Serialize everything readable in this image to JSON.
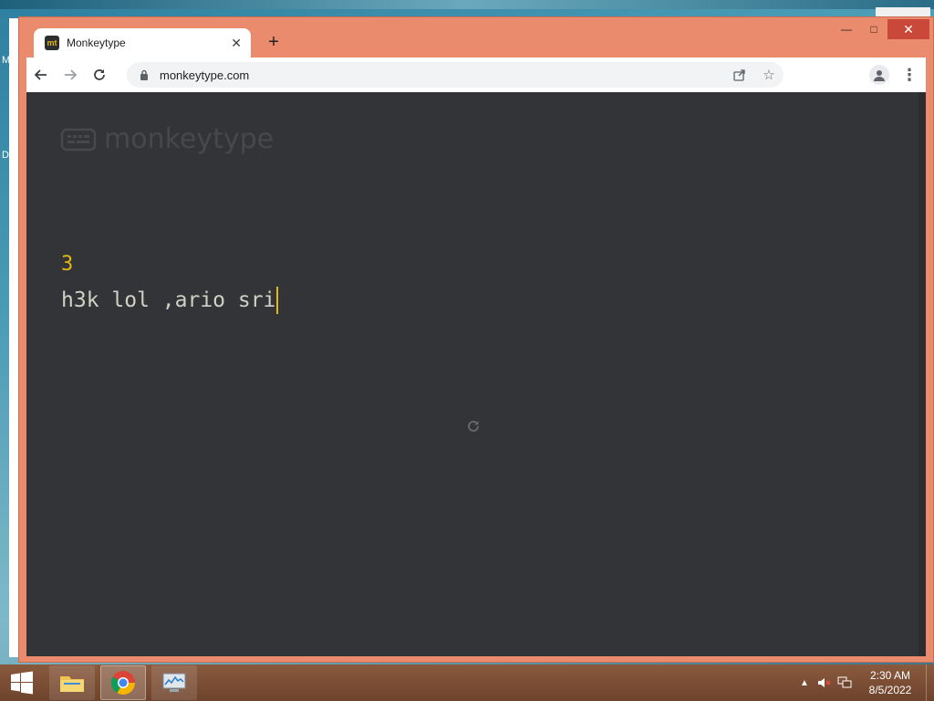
{
  "desktop": {
    "edge_letters": [
      "M",
      "D"
    ]
  },
  "browser": {
    "tab": {
      "title": "Monkeytype",
      "favicon_text": "mt",
      "close_icon": "close-icon"
    },
    "new_tab_label": "+",
    "url": "monkeytype.com",
    "window_controls": {
      "minimize": "—",
      "maximize": "□",
      "close": "✕"
    }
  },
  "page": {
    "logo_text": "monkeytype",
    "timer": "3",
    "typed_text": "h3k lol ,ario sri",
    "colors": {
      "background": "#323437",
      "main": "#e2b714",
      "text": "#d1d0c5",
      "sub": "#46484c"
    }
  },
  "taskbar": {
    "apps": [
      {
        "name": "file-explorer"
      },
      {
        "name": "chrome",
        "active": true
      },
      {
        "name": "task-manager"
      }
    ],
    "tray": {
      "time": "2:30 AM",
      "date": "8/5/2022"
    }
  }
}
